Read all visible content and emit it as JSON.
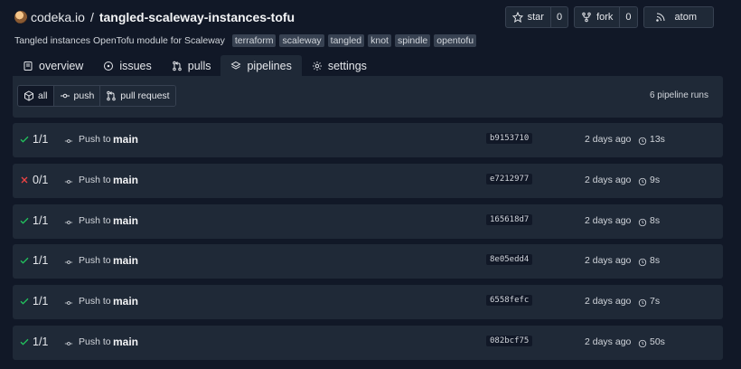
{
  "header": {
    "owner": "codeka.io",
    "separator": "/",
    "repo": "tangled-scaleway-instances-tofu",
    "star_label": "star",
    "star_count": "0",
    "fork_label": "fork",
    "fork_count": "0",
    "atom_label": "atom"
  },
  "description": "Tangled instances OpenTofu module for Scaleway",
  "topics": [
    "terraform",
    "scaleway",
    "tangled",
    "knot",
    "spindle",
    "opentofu"
  ],
  "tabs": [
    {
      "label": "overview",
      "icon": "book-icon"
    },
    {
      "label": "issues",
      "icon": "circle-dot-icon"
    },
    {
      "label": "pulls",
      "icon": "git-pull-request-icon"
    },
    {
      "label": "pipelines",
      "icon": "layers-icon",
      "active": true
    },
    {
      "label": "settings",
      "icon": "gear-icon"
    }
  ],
  "filters": [
    {
      "label": "all",
      "icon": "box-icon",
      "active": true
    },
    {
      "label": "push",
      "icon": "git-commit-icon"
    },
    {
      "label": "pull request",
      "icon": "git-pull-request-icon"
    }
  ],
  "run_count": "6 pipeline runs",
  "runs": [
    {
      "status": "success",
      "ratio": "1/1",
      "trigger": "Push to",
      "branch": "main",
      "sha": "b9153710",
      "ago": "2 days ago",
      "duration": "13s"
    },
    {
      "status": "failure",
      "ratio": "0/1",
      "trigger": "Push to",
      "branch": "main",
      "sha": "e7212977",
      "ago": "2 days ago",
      "duration": "9s"
    },
    {
      "status": "success",
      "ratio": "1/1",
      "trigger": "Push to",
      "branch": "main",
      "sha": "165618d7",
      "ago": "2 days ago",
      "duration": "8s"
    },
    {
      "status": "success",
      "ratio": "1/1",
      "trigger": "Push to",
      "branch": "main",
      "sha": "8e05edd4",
      "ago": "2 days ago",
      "duration": "8s"
    },
    {
      "status": "success",
      "ratio": "1/1",
      "trigger": "Push to",
      "branch": "main",
      "sha": "6558fefc",
      "ago": "2 days ago",
      "duration": "7s"
    },
    {
      "status": "success",
      "ratio": "1/1",
      "trigger": "Push to",
      "branch": "main",
      "sha": "082bcf75",
      "ago": "2 days ago",
      "duration": "50s"
    }
  ],
  "colors": {
    "background": "#111827",
    "surface": "#1f2937",
    "success": "#22c55e",
    "failure": "#ef4444"
  }
}
